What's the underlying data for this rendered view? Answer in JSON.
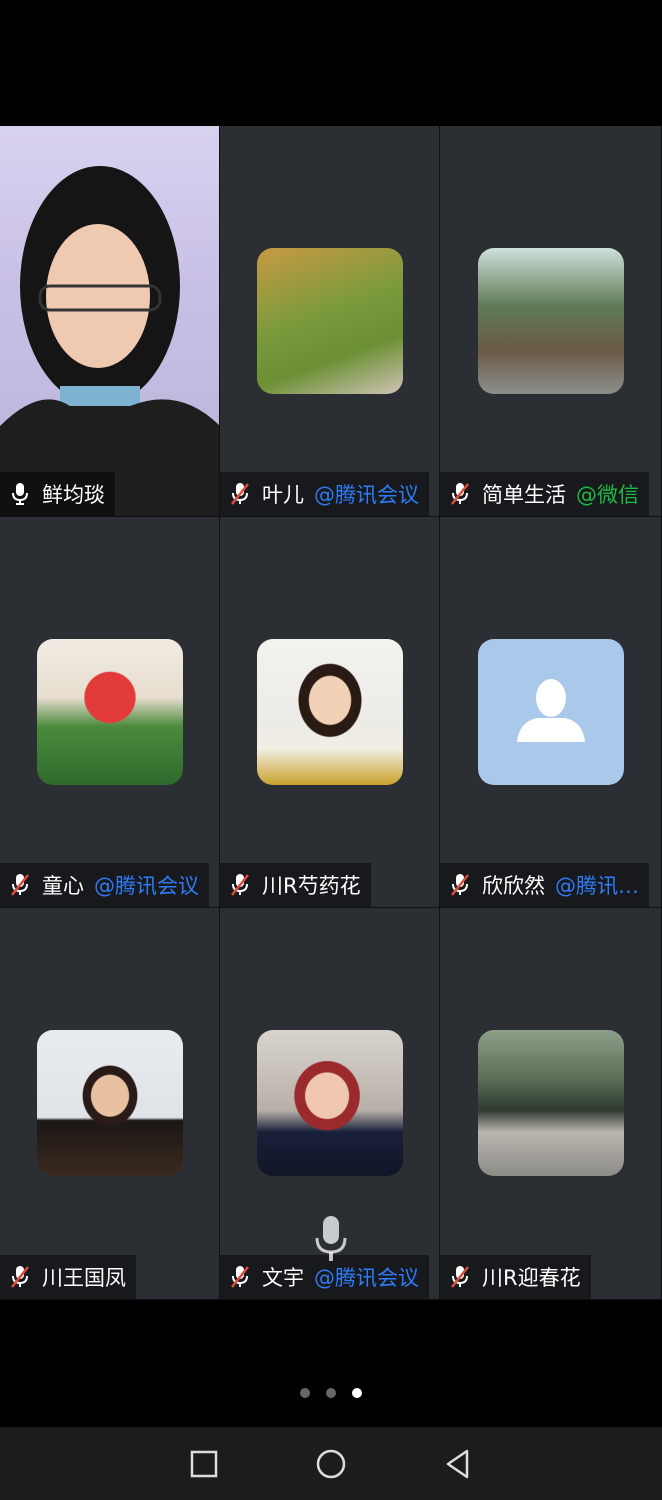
{
  "page": {
    "current_page_index": 2,
    "page_count": 3
  },
  "participants": [
    {
      "name": "鲜均琰",
      "tag": "",
      "tag_type": "",
      "mic": "on",
      "video": true
    },
    {
      "name": "叶儿",
      "tag": "@腾讯会议",
      "tag_type": "tencent",
      "mic": "muted",
      "video": false
    },
    {
      "name": "简单生活",
      "tag": "@微信",
      "tag_type": "wechat",
      "mic": "muted",
      "video": false
    },
    {
      "name": "童心",
      "tag": "@腾讯会议",
      "tag_type": "tencent",
      "mic": "muted",
      "video": false
    },
    {
      "name": "川R芍药花",
      "tag": "",
      "tag_type": "",
      "mic": "muted",
      "video": false
    },
    {
      "name": "欣欣然",
      "tag": "@腾讯…",
      "tag_type": "tencent",
      "mic": "muted",
      "video": false,
      "avatar": "default-person"
    },
    {
      "name": "川王国凤",
      "tag": "",
      "tag_type": "",
      "mic": "muted",
      "video": false
    },
    {
      "name": "文宇",
      "tag": "@腾讯会议",
      "tag_type": "tencent",
      "mic": "muted",
      "video": false
    },
    {
      "name": "川R迎春花",
      "tag": "",
      "tag_type": "",
      "mic": "muted",
      "video": false
    }
  ],
  "colors": {
    "tag_tencent": "#2f7bf5",
    "tag_wechat": "#1fb845",
    "tile_bg": "#2b2e33",
    "default_avatar_bg": "#a9c8ea"
  },
  "icons": {
    "mic_on": "microphone-icon",
    "mic_muted": "microphone-muted-icon",
    "overlay": "microphone-icon",
    "nav": [
      "square-recents-icon",
      "circle-home-icon",
      "triangle-back-icon"
    ]
  }
}
